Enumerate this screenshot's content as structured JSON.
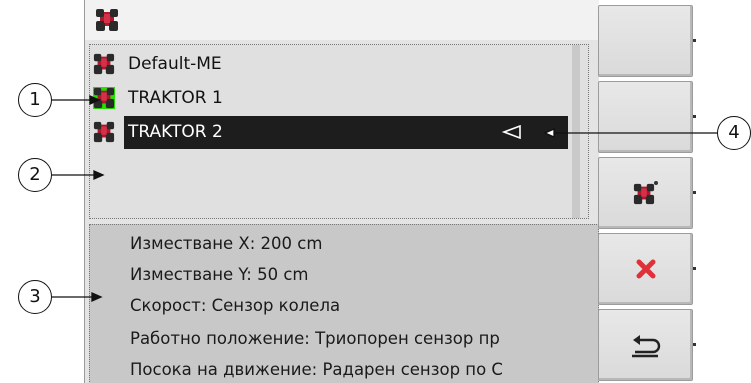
{
  "list": {
    "items": [
      {
        "label": "Default-ME",
        "active": false,
        "selected": false
      },
      {
        "label": "TRAKTOR 1",
        "active": true,
        "selected": false
      },
      {
        "label": "TRAKTOR 2",
        "active": false,
        "selected": true
      }
    ]
  },
  "details": {
    "lines": [
      "Изместване X: 200 cm",
      "Изместване Y: 50 cm",
      "Скорост: Сензор колела",
      "Работно положение: Триопорен сензор пр",
      "Посока на движение: Радарен сензор по С"
    ]
  },
  "softkeys": [
    {
      "icon": "blank"
    },
    {
      "icon": "blank"
    },
    {
      "icon": "tractor-add-icon"
    },
    {
      "icon": "delete-x-icon"
    },
    {
      "icon": "back-return-icon"
    }
  ],
  "callouts": {
    "c1": "1",
    "c2": "2",
    "c3": "3",
    "c4": "4"
  },
  "colors": {
    "active_highlight": "#22e000",
    "selection_bg": "#1d1d1d",
    "icon_red": "#b0182a"
  }
}
